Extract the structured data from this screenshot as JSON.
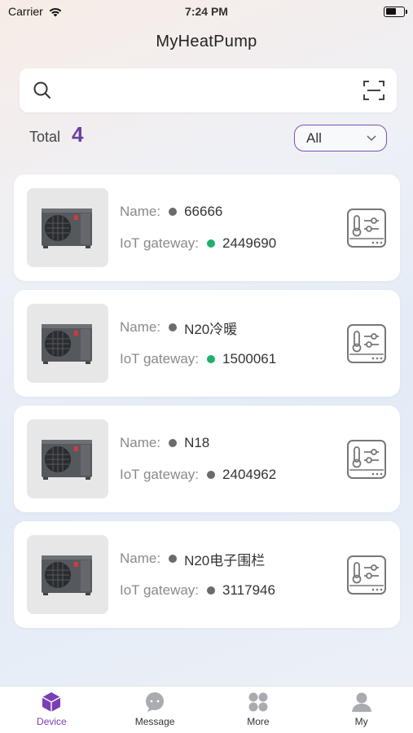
{
  "status_bar": {
    "carrier": "Carrier",
    "time": "7:24 PM"
  },
  "header": {
    "title": "MyHeatPump"
  },
  "search": {
    "placeholder": ""
  },
  "summary": {
    "total_label": "Total",
    "total_count": "4"
  },
  "filter": {
    "selected": "All"
  },
  "colors": {
    "accent": "#7a3fb5",
    "online": "#1fb16a",
    "offline": "#6b6b6b"
  },
  "devices": [
    {
      "name_label": "Name:",
      "name": "66666",
      "name_status": "offline",
      "gateway_label": "IoT gateway:",
      "gateway": "2449690",
      "gateway_status": "online"
    },
    {
      "name_label": "Name:",
      "name": "N20冷暖",
      "name_status": "offline",
      "gateway_label": "IoT gateway:",
      "gateway": "1500061",
      "gateway_status": "online"
    },
    {
      "name_label": "Name:",
      "name": "N18",
      "name_status": "offline",
      "gateway_label": "IoT gateway:",
      "gateway": "2404962",
      "gateway_status": "offline"
    },
    {
      "name_label": "Name:",
      "name": "N20电子围栏",
      "name_status": "offline",
      "gateway_label": "IoT gateway:",
      "gateway": "3117946",
      "gateway_status": "offline"
    }
  ],
  "tabs": [
    {
      "label": "Device",
      "icon": "cube-icon",
      "active": true
    },
    {
      "label": "Message",
      "icon": "chat-bubble-icon",
      "active": false
    },
    {
      "label": "More",
      "icon": "grid-icon",
      "active": false
    },
    {
      "label": "My",
      "icon": "user-icon",
      "active": false
    }
  ]
}
